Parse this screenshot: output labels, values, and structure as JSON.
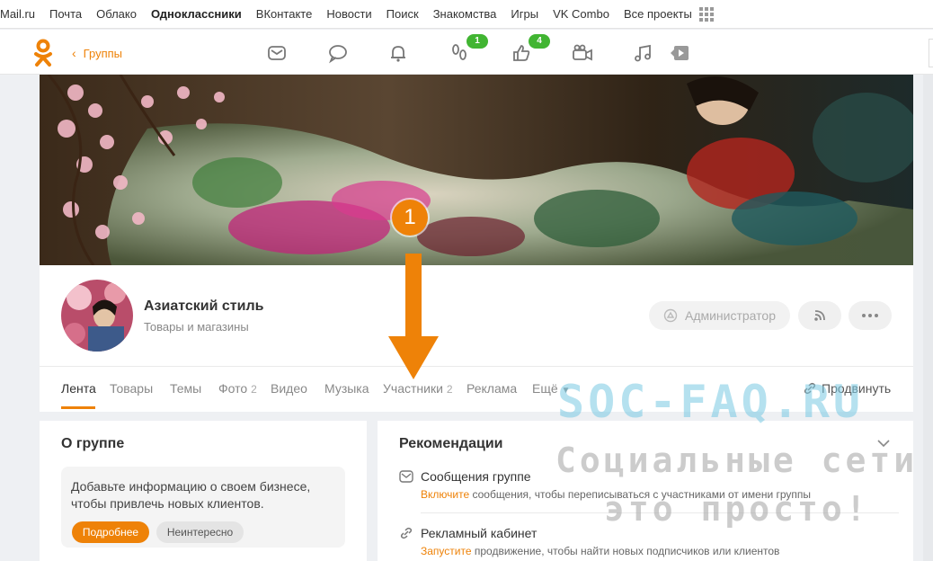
{
  "portal_nav": {
    "items": [
      "Mail.ru",
      "Почта",
      "Облако",
      "Одноклассники",
      "ВКонтакте",
      "Новости",
      "Поиск",
      "Знакомства",
      "Игры",
      "VK Combo",
      "Все проекты"
    ],
    "active": "Одноклассники"
  },
  "ok_header": {
    "back_label": "Группы",
    "guests_badge": "1",
    "likes_badge": "4"
  },
  "group": {
    "name": "Азиатский стиль",
    "category": "Товары и магазины",
    "admin_label": "Администратор"
  },
  "tabs": [
    {
      "label": "Лента",
      "count": ""
    },
    {
      "label": "Товары",
      "count": ""
    },
    {
      "label": "Темы",
      "count": ""
    },
    {
      "label": "Фото",
      "count": "2"
    },
    {
      "label": "Видео",
      "count": ""
    },
    {
      "label": "Музыка",
      "count": ""
    },
    {
      "label": "Участники",
      "count": "2"
    },
    {
      "label": "Реклама",
      "count": ""
    },
    {
      "label": "Ещё",
      "count": ""
    }
  ],
  "promote_label": "Продвинуть",
  "about": {
    "title": "О группе",
    "text": "Добавьте информацию о своем бизнесе, чтобы привлечь новых клиентов.",
    "more_button": "Подробнее",
    "dismiss_button": "Неинтересно"
  },
  "recommendations": {
    "title": "Рекомендации",
    "items": [
      {
        "title": "Сообщения группе",
        "action": "Включите",
        "rest": " сообщения, чтобы переписываться с участниками от имени группы"
      },
      {
        "title": "Рекламный кабинет",
        "action": "Запустите",
        "rest": " продвижение, чтобы найти новых подписчиков или клиентов"
      }
    ]
  },
  "annotation": {
    "step": "1"
  },
  "watermark": {
    "line1": "SOC-FAQ.RU",
    "line2": "Социальные сети",
    "line3": "это просто!"
  },
  "colors": {
    "accent": "#ee8208",
    "badge": "#41b532"
  }
}
